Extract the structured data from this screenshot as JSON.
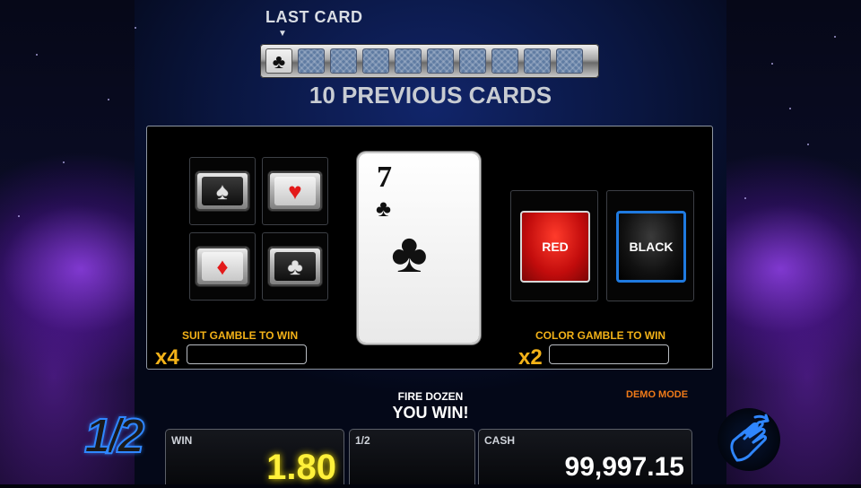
{
  "history": {
    "last_card_label": "LAST CARD",
    "last_card_suit": "♣",
    "previous_label": "10 PREVIOUS CARDS",
    "slots": [
      "♣",
      "",
      "",
      "",
      "",
      "",
      "",
      "",
      "",
      ""
    ]
  },
  "suit_gamble": {
    "suits": [
      {
        "name": "spade",
        "symbol": "♠"
      },
      {
        "name": "heart",
        "symbol": "♥"
      },
      {
        "name": "diamond",
        "symbol": "♦"
      },
      {
        "name": "club",
        "symbol": "♣"
      }
    ],
    "label": "SUIT GAMBLE TO WIN",
    "multiplier": "x4",
    "value": ""
  },
  "current_card": {
    "rank": "7",
    "suit": "♣"
  },
  "color_gamble": {
    "red_label": "RED",
    "black_label": "BLACK",
    "label": "COLOR GAMBLE TO WIN",
    "multiplier": "x2",
    "value": ""
  },
  "messages": {
    "game_name": "FIRE DOZEN",
    "result": "YOU WIN!",
    "demo_mode": "DEMO MODE"
  },
  "bottom": {
    "half_button": "1/2",
    "win_caption": "WIN",
    "win_value": "1.80",
    "half_caption": "1/2",
    "half_value": "",
    "cash_caption": "CASH",
    "cash_value": "99,997.15"
  },
  "colors": {
    "accent_orange": "#f3b218",
    "win_yellow": "#fff13a",
    "blue_highlight": "#1f7ae0",
    "red_button": "#c20c0c"
  }
}
